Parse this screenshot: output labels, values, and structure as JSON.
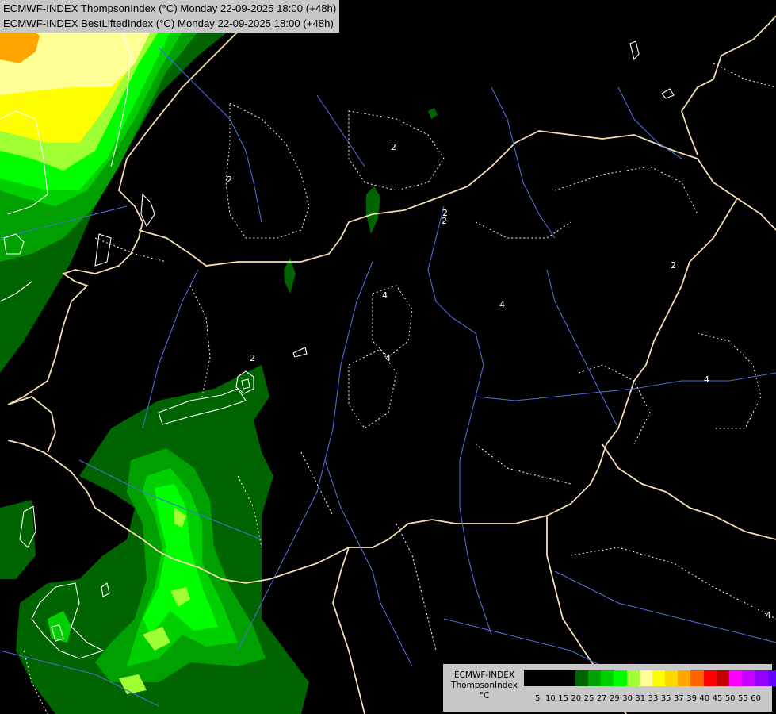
{
  "title": {
    "line1": "ECMWF-INDEX ThompsonIndex (°C) Monday 22-09-2025 18:00 (+48h)",
    "line2": "ECMWF-INDEX BestLiftedIndex (°C) Monday 22-09-2025 18:00 (+48h)"
  },
  "legend": {
    "line1": "ECMWF-INDEX",
    "line2": "ThompsonIndex",
    "line3": "°C",
    "ticks": [
      "5",
      "10",
      "15",
      "20",
      "25",
      "27",
      "29",
      "30",
      "31",
      "33",
      "35",
      "37",
      "39",
      "40",
      "45",
      "50",
      "55",
      "60"
    ],
    "colors": [
      "#000000",
      "#000000",
      "#000000",
      "#000000",
      "#006400",
      "#00a000",
      "#00d000",
      "#00ff00",
      "#a0ff32",
      "#ffff96",
      "#ffff00",
      "#ffd700",
      "#ffa500",
      "#ff6400",
      "#ff0000",
      "#c80000",
      "#ff00ff",
      "#c800ff",
      "#9600ff",
      "#6400ff",
      "#0000ff"
    ]
  },
  "contour_labels": [
    "2",
    "2",
    "2",
    "2",
    "2",
    "4",
    "4",
    "4",
    "4",
    "2",
    "4"
  ],
  "map": {
    "background": "#000000",
    "border_color": "#f5deb3",
    "river_color": "#4a6ed0",
    "contour_color": "#ffffff"
  }
}
